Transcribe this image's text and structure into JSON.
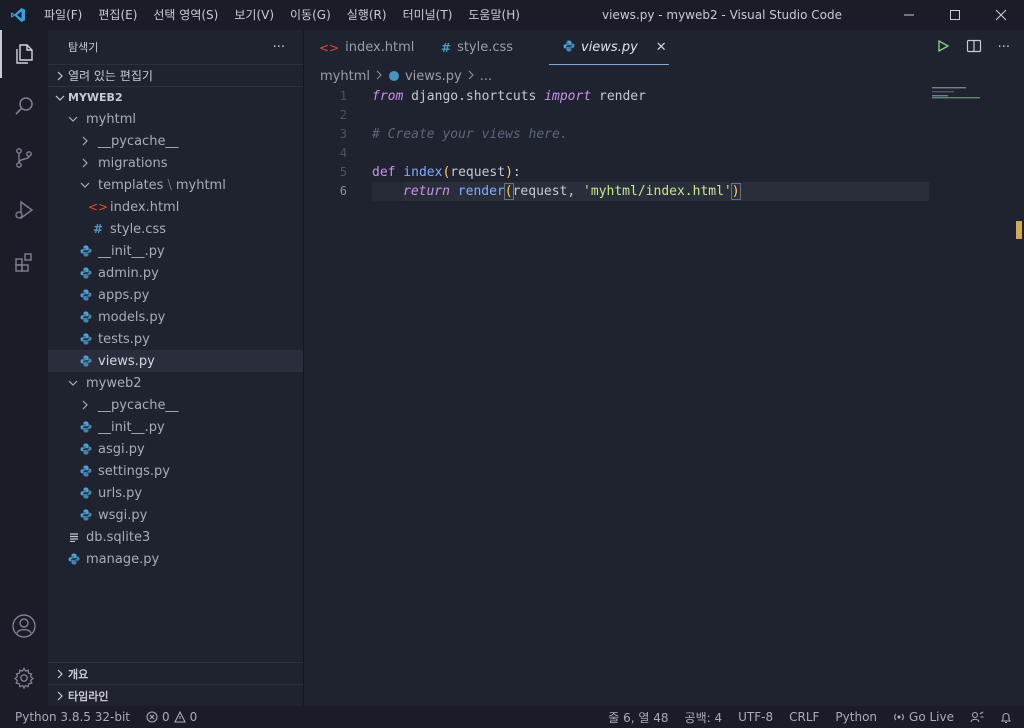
{
  "app": {
    "window_title": "views.py - myweb2 - Visual Studio Code",
    "menu": [
      "파일(F)",
      "편집(E)",
      "선택 영역(S)",
      "보기(V)",
      "이동(G)",
      "실행(R)",
      "터미널(T)",
      "도움말(H)"
    ]
  },
  "sidebar": {
    "title": "탐색기",
    "more": "···",
    "open_editors": "열려 있는 편집기",
    "workspace": "MYWEB2",
    "tree": [
      {
        "label": "myhtml",
        "depth": 1,
        "kind": "folder-open"
      },
      {
        "label": "__pycache__",
        "depth": 2,
        "kind": "folder"
      },
      {
        "label": "migrations",
        "depth": 2,
        "kind": "folder"
      },
      {
        "label": "templates",
        "extra": "myhtml",
        "depth": 2,
        "kind": "folder-open"
      },
      {
        "label": "index.html",
        "depth": 3,
        "kind": "html"
      },
      {
        "label": "style.css",
        "depth": 3,
        "kind": "css"
      },
      {
        "label": "__init__.py",
        "depth": 2,
        "kind": "py"
      },
      {
        "label": "admin.py",
        "depth": 2,
        "kind": "py"
      },
      {
        "label": "apps.py",
        "depth": 2,
        "kind": "py"
      },
      {
        "label": "models.py",
        "depth": 2,
        "kind": "py"
      },
      {
        "label": "tests.py",
        "depth": 2,
        "kind": "py"
      },
      {
        "label": "views.py",
        "depth": 2,
        "kind": "py",
        "selected": true
      },
      {
        "label": "myweb2",
        "depth": 1,
        "kind": "folder-open"
      },
      {
        "label": "__pycache__",
        "depth": 2,
        "kind": "folder"
      },
      {
        "label": "__init__.py",
        "depth": 2,
        "kind": "py"
      },
      {
        "label": "asgi.py",
        "depth": 2,
        "kind": "py"
      },
      {
        "label": "settings.py",
        "depth": 2,
        "kind": "py"
      },
      {
        "label": "urls.py",
        "depth": 2,
        "kind": "py"
      },
      {
        "label": "wsgi.py",
        "depth": 2,
        "kind": "py"
      },
      {
        "label": "db.sqlite3",
        "depth": 1,
        "kind": "file"
      },
      {
        "label": "manage.py",
        "depth": 1,
        "kind": "py"
      }
    ],
    "outline": "개요",
    "timeline": "타임라인"
  },
  "editor": {
    "tabs": [
      {
        "label": "index.html",
        "kind": "html"
      },
      {
        "label": "style.css",
        "kind": "css"
      },
      {
        "label": "views.py",
        "kind": "py",
        "active": true
      }
    ],
    "close_glyph": "✕",
    "breadcrumb": [
      "myhtml",
      "views.py",
      "..."
    ],
    "line_numbers": [
      "1",
      "2",
      "3",
      "4",
      "5",
      "6"
    ],
    "code": {
      "l1_from": "from",
      "l1_mod": " django.shortcuts ",
      "l1_import": "import",
      "l1_name": " render",
      "l3_comment": "# Create your views here.",
      "l5_def": "def",
      "l5_fn": " index",
      "l5_open": "(",
      "l5_param": "request",
      "l5_close": ")",
      "l5_colon": ":",
      "l6_return": "return",
      "l6_fn": " render",
      "l6_open": "(",
      "l6_args": "request, ",
      "l6_str": "'myhtml/index.html'",
      "l6_close": ")"
    }
  },
  "statusbar": {
    "python": "Python 3.8.5 32-bit",
    "errors": "0",
    "warnings": "0",
    "position": "줄 6, 열 48",
    "spaces": "공백: 4",
    "encoding": "UTF-8",
    "eol": "CRLF",
    "language": "Python",
    "golive": "Go Live"
  },
  "colors": {
    "accent": "#7fa9d4",
    "background": "#1f2330",
    "chrome": "#1a1d28",
    "python_icon": "#4f9fcf",
    "html_icon": "#e44d26",
    "css_icon": "#519aba"
  }
}
